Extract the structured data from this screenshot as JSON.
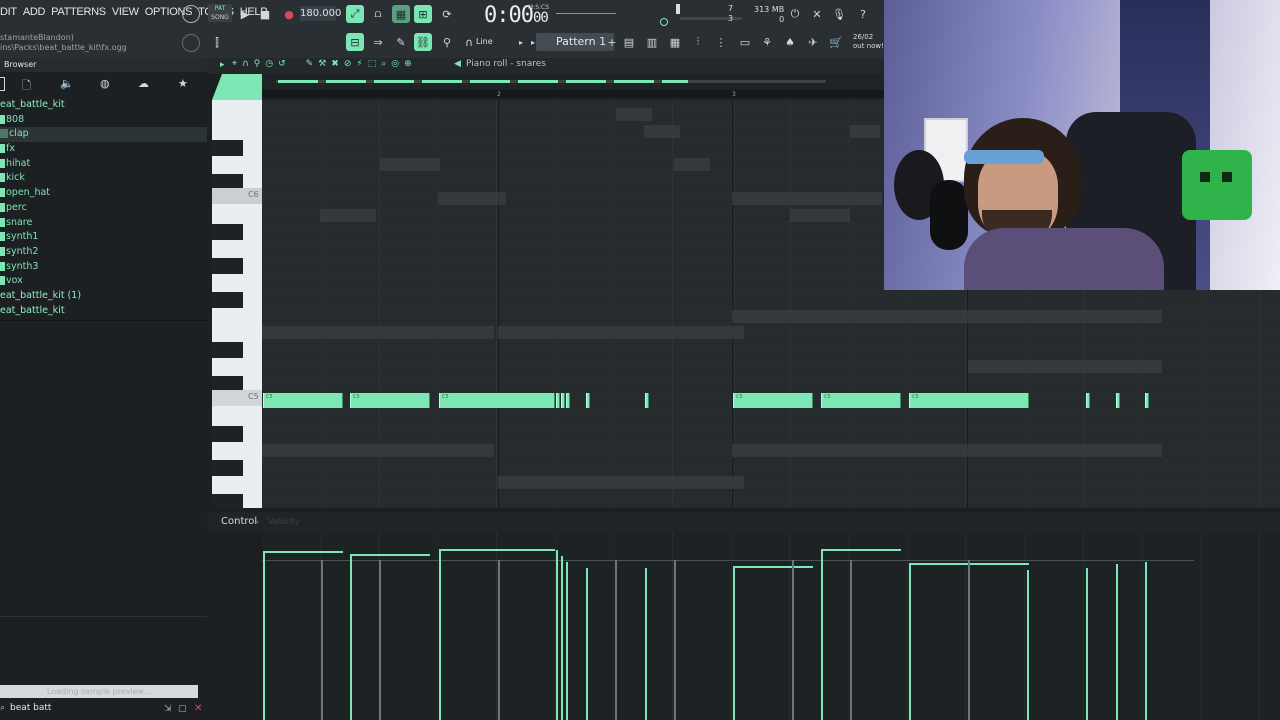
{
  "menu": [
    "DIT",
    "ADD",
    "PATTERNS",
    "VIEW",
    "OPTIONS",
    "TOOLS",
    "HELP"
  ],
  "hint_lines": [
    "stamanteBlandon)",
    "ins\\Packs\\beat_battle_kit\\fx.ogg"
  ],
  "transport": {
    "pat_label": "PAT",
    "song_label": "SONG",
    "tempo": "180.000",
    "time": "0:00",
    "time_sub": "00",
    "time_unit": "M:S:CS"
  },
  "monitor": {
    "bars": "7",
    "voices": "3",
    "memory": "313 MB",
    "cpu": "0"
  },
  "toolbar": {
    "snap": "Line",
    "pattern": "Pattern 1",
    "date": "26/02",
    "news": "out now!"
  },
  "browser": {
    "title": "Browser",
    "items": [
      {
        "label": "eat_battle_kit",
        "root": true
      },
      {
        "label": "808"
      },
      {
        "label": "clap",
        "selected": true
      },
      {
        "label": "fx"
      },
      {
        "label": "hihat"
      },
      {
        "label": "kick"
      },
      {
        "label": "open_hat"
      },
      {
        "label": "perc"
      },
      {
        "label": "snare"
      },
      {
        "label": "synth1"
      },
      {
        "label": "synth2"
      },
      {
        "label": "synth3"
      },
      {
        "label": "vox"
      },
      {
        "label": "eat_battle_kit (1)",
        "root": true
      },
      {
        "label": "eat_battle_kit",
        "root": true
      }
    ],
    "loading": "Loading sample preview...",
    "search": "beat batt"
  },
  "piano_roll": {
    "title": "Piano roll - snares",
    "bar_numbers": [
      "2",
      "3"
    ],
    "key_labels": [
      "C6",
      "C5"
    ],
    "note_label": "C5",
    "control_label": "Control",
    "velocity_label": "Velocity"
  },
  "colors": {
    "accent": "#7de8b5",
    "bg": "#262b2e"
  }
}
